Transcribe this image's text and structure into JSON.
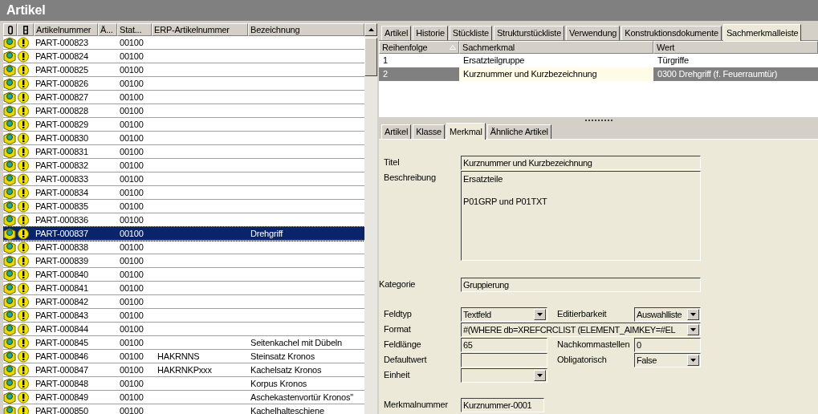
{
  "window": {
    "title": "Artikel"
  },
  "parts_table": {
    "columns": [
      "Artikelnummer",
      "Ä...",
      "Stat...",
      "ERP-Artikelnummer",
      "Bezeichnung"
    ],
    "rows": [
      {
        "number": "PART-000823",
        "status": "00100",
        "selected": false
      },
      {
        "number": "PART-000824",
        "status": "00100",
        "selected": false
      },
      {
        "number": "PART-000825",
        "status": "00100",
        "selected": false
      },
      {
        "number": "PART-000826",
        "status": "00100",
        "selected": false
      },
      {
        "number": "PART-000827",
        "status": "00100",
        "selected": false
      },
      {
        "number": "PART-000828",
        "status": "00100",
        "selected": false
      },
      {
        "number": "PART-000829",
        "status": "00100",
        "selected": false
      },
      {
        "number": "PART-000830",
        "status": "00100",
        "selected": false
      },
      {
        "number": "PART-000831",
        "status": "00100",
        "selected": false
      },
      {
        "number": "PART-000832",
        "status": "00100",
        "selected": false
      },
      {
        "number": "PART-000833",
        "status": "00100",
        "selected": false
      },
      {
        "number": "PART-000834",
        "status": "00100",
        "selected": false
      },
      {
        "number": "PART-000835",
        "status": "00100",
        "selected": false
      },
      {
        "number": "PART-000836",
        "status": "00100",
        "selected": false
      },
      {
        "number": "PART-000837",
        "status": "00100",
        "name": "Drehgriff",
        "selected": true
      },
      {
        "number": "PART-000838",
        "status": "00100",
        "selected": false
      },
      {
        "number": "PART-000839",
        "status": "00100",
        "selected": false
      },
      {
        "number": "PART-000840",
        "status": "00100",
        "selected": false
      },
      {
        "number": "PART-000841",
        "status": "00100",
        "selected": false
      },
      {
        "number": "PART-000842",
        "status": "00100",
        "selected": false
      },
      {
        "number": "PART-000843",
        "status": "00100",
        "selected": false
      },
      {
        "number": "PART-000844",
        "status": "00100",
        "selected": false
      },
      {
        "number": "PART-000845",
        "status": "00100",
        "name": "Seitenkachel mit Dübeln",
        "selected": false
      },
      {
        "number": "PART-000846",
        "status": "00100",
        "erp": "HAKRNNS",
        "name": "Steinsatz Kronos",
        "selected": false
      },
      {
        "number": "PART-000847",
        "status": "00100",
        "erp": "HAKRNKPxxx",
        "name": "Kachelsatz Kronos",
        "selected": false
      },
      {
        "number": "PART-000848",
        "status": "00100",
        "name": "Korpus Kronos",
        "selected": false
      },
      {
        "number": "PART-000849",
        "status": "00100",
        "name": "Aschekastenvortür Kronos\"",
        "selected": false
      },
      {
        "number": "PART-000850",
        "status": "00100",
        "name": "Kachelhalteschiene",
        "selected": false
      }
    ]
  },
  "top_tabs": [
    {
      "label": "Artikel",
      "selected": false
    },
    {
      "label": "Historie",
      "selected": false
    },
    {
      "label": "Stückliste",
      "selected": false
    },
    {
      "label": "Strukturstückliste",
      "selected": false
    },
    {
      "label": "Verwendung",
      "selected": false
    },
    {
      "label": "Konstruktionsdokumente",
      "selected": false
    },
    {
      "label": "Sachmerkmalleiste",
      "selected": true
    }
  ],
  "features_table": {
    "columns": [
      "Reihenfolge",
      "Sachmerkmal",
      "Wert"
    ],
    "rows": [
      {
        "order": "1",
        "feature": "Ersatzteilgruppe",
        "value": "Türgriffe",
        "selected": false
      },
      {
        "order": "2",
        "feature": "Kurznummer und Kurzbezeichnung",
        "value": "0300 Drehgriff (f. Feuerraumtür)",
        "selected": true
      }
    ]
  },
  "detail_tabs": [
    {
      "label": "Artikel",
      "selected": false
    },
    {
      "label": "Klasse",
      "selected": false
    },
    {
      "label": "Merkmal",
      "selected": true
    },
    {
      "label": "Ähnliche Artikel",
      "selected": false
    }
  ],
  "form": {
    "titel": {
      "label": "Titel",
      "value": "Kurznummer und Kurzbezeichnung"
    },
    "beschreibung": {
      "label": "Beschreibung",
      "lines": [
        "Ersatzteile",
        "P01GRP und P01TXT"
      ]
    },
    "kategorie": {
      "label": "Kategorie",
      "value": "Gruppierung"
    },
    "feldtyp": {
      "label": "Feldtyp",
      "value": "Textfeld"
    },
    "editierbarkeit": {
      "label": "Editierbarkeit",
      "value": "Auswahlliste"
    },
    "format": {
      "label": "Format",
      "value": "#(WHERE db=XREFCRCLIST (ELEMENT_AIMKEY=#EL"
    },
    "feldlaenge": {
      "label": "Feldlänge",
      "value": "65"
    },
    "nachkommastellen": {
      "label": "Nachkommastellen",
      "value": "0"
    },
    "defaultwert": {
      "label": "Defaultwert"
    },
    "obligatorisch": {
      "label": "Obligatorisch",
      "value": "False"
    },
    "einheit": {
      "label": "Einheit"
    },
    "merkmalnummer": {
      "label": "Merkmalnummer",
      "value": "Kurznummer-0001"
    }
  }
}
